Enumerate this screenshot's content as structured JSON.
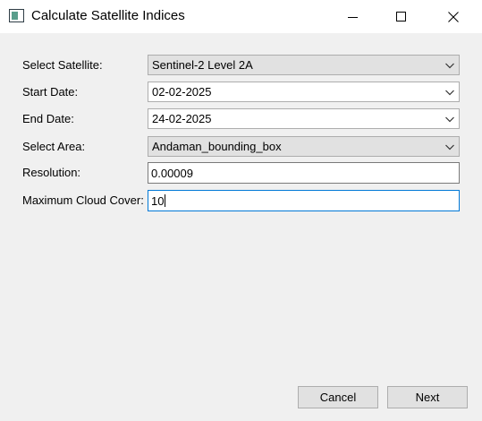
{
  "window": {
    "title": "Calculate Satellite Indices",
    "icons": {
      "app": "app-window-icon",
      "minimize": "minimize-icon",
      "maximize": "maximize-icon",
      "close": "close-icon"
    }
  },
  "form": {
    "satellite": {
      "label": "Select Satellite:",
      "value": "Sentinel-2 Level 2A"
    },
    "start_date": {
      "label": "Start Date:",
      "value": "02-02-2025"
    },
    "end_date": {
      "label": "End Date:",
      "value": "24-02-2025"
    },
    "area": {
      "label": "Select Area:",
      "value": "Andaman_bounding_box"
    },
    "resolution": {
      "label": "Resolution:",
      "value": "0.00009"
    },
    "cloud_cover": {
      "label": "Maximum Cloud Cover:",
      "value": "10"
    }
  },
  "buttons": {
    "cancel": "Cancel",
    "next": "Next"
  },
  "colors": {
    "focus_border": "#0078d7",
    "window_background": "#f0f0f0"
  }
}
